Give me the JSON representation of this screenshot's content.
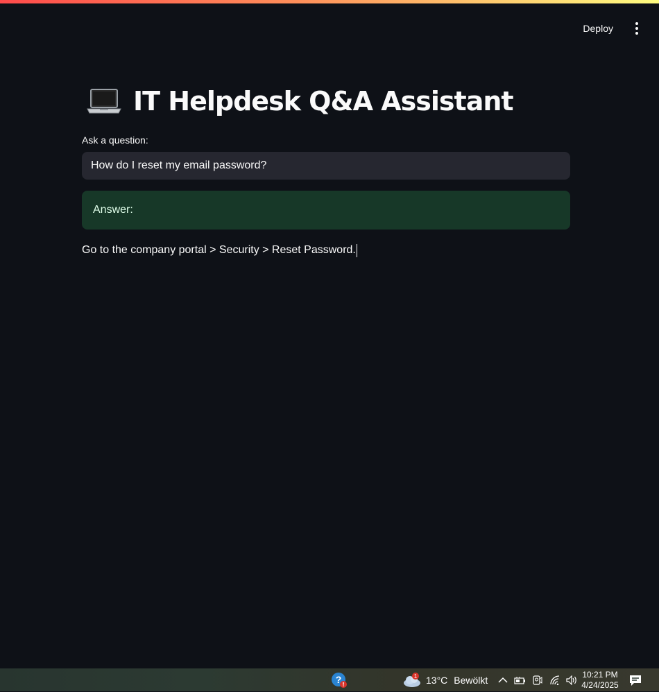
{
  "header": {
    "deploy_label": "Deploy",
    "menu_icon": "more-vertical-icon"
  },
  "main": {
    "title_icon": "laptop-icon",
    "title": "IT Helpdesk Q&A Assistant",
    "question_label": "Ask a question:",
    "question_value": "How do I reset my email password?",
    "answer_label": "Answer:",
    "answer_text": "Go to the company portal > Security > Reset Password."
  },
  "taskbar": {
    "help_icon": "help-icon",
    "weather": {
      "icon": "cloud-icon",
      "badge": "1",
      "temperature": "13°C",
      "condition": "Bewölkt"
    },
    "tray_icons": [
      "chevron-up-icon",
      "battery-icon",
      "camera-icon",
      "wifi-icon",
      "volume-icon"
    ],
    "clock": {
      "time": "10:21 PM",
      "date": "4/24/2025"
    },
    "notification_icon": "notification-icon"
  },
  "colors": {
    "background": "#0e1117",
    "input_background": "#262730",
    "answer_background": "#213a2b",
    "text": "#fafafa"
  }
}
